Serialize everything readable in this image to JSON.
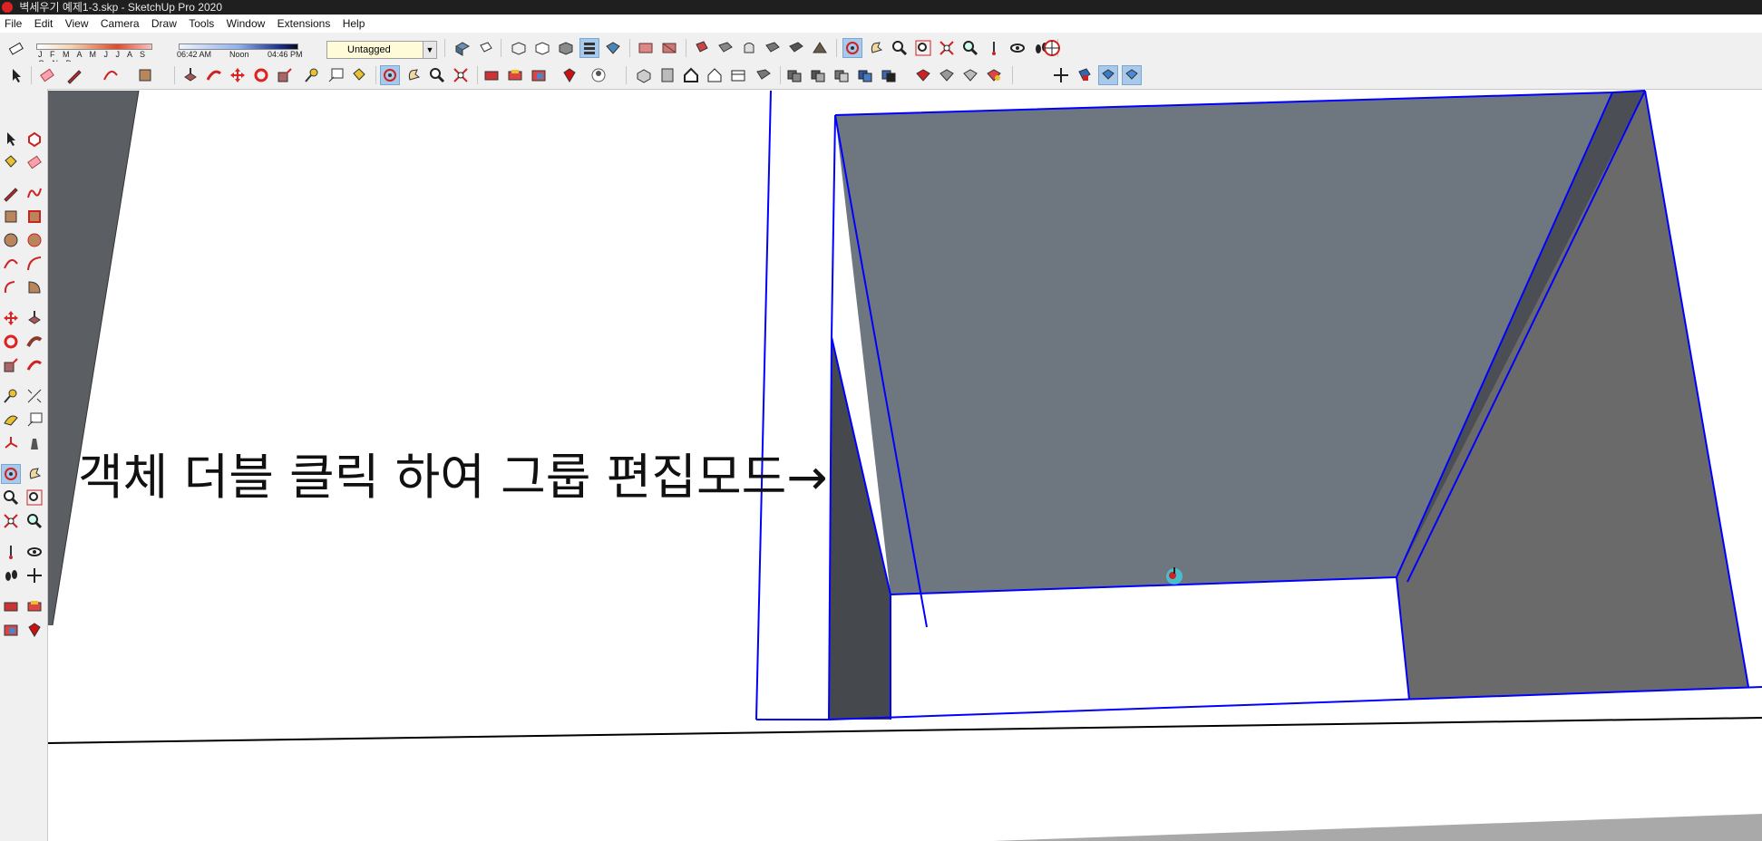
{
  "window": {
    "title": "벽세우기 예제1-3.skp - SketchUp Pro 2020",
    "app_icon": "sketchup-icon"
  },
  "menu": [
    "File",
    "Edit",
    "View",
    "Camera",
    "Draw",
    "Tools",
    "Window",
    "Extensions",
    "Help"
  ],
  "shadows": {
    "months": "J F M A M J J A S O N D",
    "time_start": "06:42 AM",
    "time_mid": "Noon",
    "time_end": "04:46 PM"
  },
  "tag_dropdown": {
    "selected": "Untagged"
  },
  "viewport": {
    "caption": "객체 더블 클릭 하여 그룹 편집모드→",
    "colors": {
      "wall_back": "#6e7780",
      "wall_side_dark": "#45484c",
      "wall_right": "#6a6a6a",
      "selection_edge": "#0000ff",
      "ground_edge": "#000000"
    }
  },
  "icons": {
    "top_row": [
      "eraser-icon",
      "shadow-settings-icon",
      "xray-icon",
      "back-edges-icon",
      "wireframe-icon",
      "hidden-line-icon",
      "shaded-icon",
      "shaded-textures-icon",
      "monochrome-icon",
      "section-plane-icon",
      "orbit-icon",
      "pan-icon",
      "zoom-icon",
      "zoom-extents-icon",
      "walk-icon",
      "look-around-icon",
      "position-camera-icon",
      "geo-location-icon"
    ],
    "second_row": [
      "select-icon",
      "eraser-icon",
      "pencil-icon",
      "arc-icon",
      "rectangle-icon",
      "push-pull-icon",
      "follow-me-icon",
      "move-icon",
      "rotate-icon",
      "scale-icon",
      "tape-measure-icon",
      "text-icon",
      "paint-bucket-icon",
      "orbit-icon",
      "pan-icon",
      "zoom-icon",
      "zoom-extents-icon",
      "warehouse-icon",
      "extension-icon",
      "iso-view-icon",
      "top-view-icon",
      "front-view-icon",
      "right-view-icon",
      "back-view-icon",
      "left-view-icon",
      "solid-tools-icon",
      "section-display-icon"
    ]
  }
}
